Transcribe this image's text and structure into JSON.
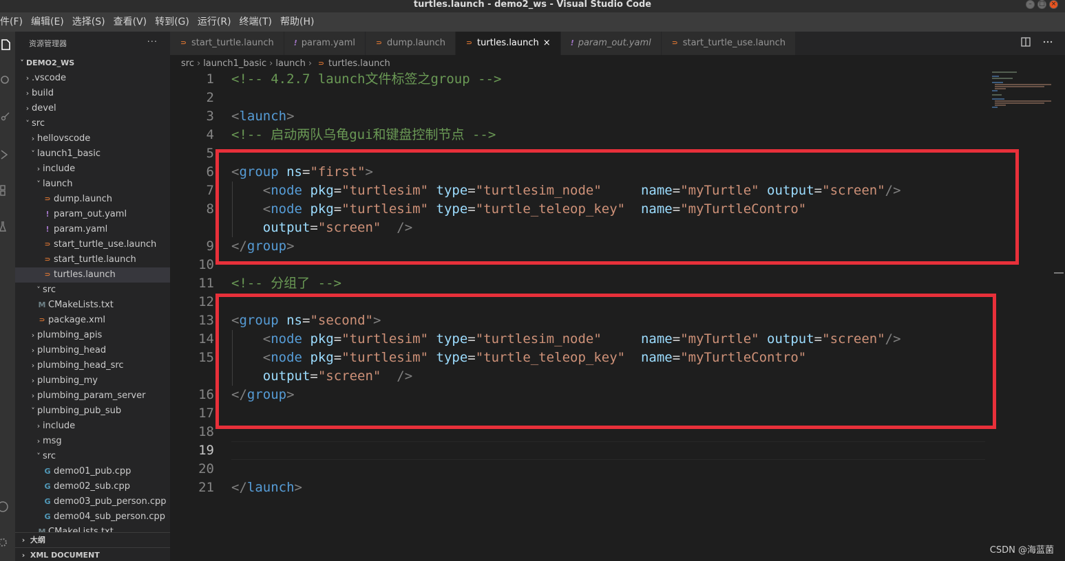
{
  "window": {
    "title": "turtles.launch - demo2_ws - Visual Studio Code",
    "buttons": [
      "–",
      "□",
      "×"
    ]
  },
  "menu": [
    "件(F)",
    "编辑(E)",
    "选择(S)",
    "查看(V)",
    "转到(G)",
    "运行(R)",
    "终端(T)",
    "帮助(H)"
  ],
  "activity_icons": [
    "files-icon",
    "search-icon",
    "source-control-icon",
    "run-debug-icon",
    "extensions-icon",
    "test-icon",
    "account-icon",
    "settings-gear-icon"
  ],
  "sidebar": {
    "header": "资源管理器",
    "more": "···",
    "tree": [
      {
        "label": "DEMO2_WS",
        "depth": 0,
        "chevron": "down",
        "icon": "",
        "root": true
      },
      {
        "label": ".vscode",
        "depth": 1,
        "chevron": "right",
        "icon": ""
      },
      {
        "label": "build",
        "depth": 1,
        "chevron": "right",
        "icon": ""
      },
      {
        "label": "devel",
        "depth": 1,
        "chevron": "right",
        "icon": ""
      },
      {
        "label": "src",
        "depth": 1,
        "chevron": "down",
        "icon": ""
      },
      {
        "label": "hellovscode",
        "depth": 2,
        "chevron": "right",
        "icon": ""
      },
      {
        "label": "launch1_basic",
        "depth": 2,
        "chevron": "down",
        "icon": ""
      },
      {
        "label": "include",
        "depth": 3,
        "chevron": "right",
        "icon": ""
      },
      {
        "label": "launch",
        "depth": 3,
        "chevron": "down",
        "icon": ""
      },
      {
        "label": "dump.launch",
        "depth": 4,
        "chevron": "",
        "icon": "rss"
      },
      {
        "label": "param_out.yaml",
        "depth": 4,
        "chevron": "",
        "icon": "yaml"
      },
      {
        "label": "param.yaml",
        "depth": 4,
        "chevron": "",
        "icon": "yaml"
      },
      {
        "label": "start_turtle_use.launch",
        "depth": 4,
        "chevron": "",
        "icon": "rss"
      },
      {
        "label": "start_turtle.launch",
        "depth": 4,
        "chevron": "",
        "icon": "rss"
      },
      {
        "label": "turtles.launch",
        "depth": 4,
        "chevron": "",
        "icon": "rss",
        "selected": true
      },
      {
        "label": "src",
        "depth": 3,
        "chevron": "down",
        "icon": ""
      },
      {
        "label": "CMakeLists.txt",
        "depth": 3,
        "chevron": "",
        "icon": "cmake"
      },
      {
        "label": "package.xml",
        "depth": 3,
        "chevron": "",
        "icon": "rss"
      },
      {
        "label": "plumbing_apis",
        "depth": 2,
        "chevron": "right",
        "icon": ""
      },
      {
        "label": "plumbing_head",
        "depth": 2,
        "chevron": "right",
        "icon": ""
      },
      {
        "label": "plumbing_head_src",
        "depth": 2,
        "chevron": "right",
        "icon": ""
      },
      {
        "label": "plumbing_my",
        "depth": 2,
        "chevron": "right",
        "icon": ""
      },
      {
        "label": "plumbing_param_server",
        "depth": 2,
        "chevron": "right",
        "icon": ""
      },
      {
        "label": "plumbing_pub_sub",
        "depth": 2,
        "chevron": "down",
        "icon": ""
      },
      {
        "label": "include",
        "depth": 3,
        "chevron": "right",
        "icon": ""
      },
      {
        "label": "msg",
        "depth": 3,
        "chevron": "right",
        "icon": ""
      },
      {
        "label": "src",
        "depth": 3,
        "chevron": "down",
        "icon": ""
      },
      {
        "label": "demo01_pub.cpp",
        "depth": 4,
        "chevron": "",
        "icon": "cpp"
      },
      {
        "label": "demo02_sub.cpp",
        "depth": 4,
        "chevron": "",
        "icon": "cpp"
      },
      {
        "label": "demo03_pub_person.cpp",
        "depth": 4,
        "chevron": "",
        "icon": "cpp"
      },
      {
        "label": "demo04_sub_person.cpp",
        "depth": 4,
        "chevron": "",
        "icon": "cpp"
      },
      {
        "label": "CMakeLists.txt",
        "depth": 3,
        "chevron": "",
        "icon": "cmake"
      }
    ],
    "outline_label": "大纲",
    "xml_document_label": "XML DOCUMENT"
  },
  "tabs": [
    {
      "label": "start_turtle.launch",
      "icon": "rss"
    },
    {
      "label": "param.yaml",
      "icon": "yaml"
    },
    {
      "label": "dump.launch",
      "icon": "rss"
    },
    {
      "label": "turtles.launch",
      "icon": "rss",
      "active": true,
      "close": "×"
    },
    {
      "label": "param_out.yaml",
      "icon": "yaml",
      "italic": true
    },
    {
      "label": "start_turtle_use.launch",
      "icon": "rss"
    }
  ],
  "tab_actions": [
    "split-editor-icon",
    "more-actions-icon"
  ],
  "breadcrumb": [
    "src",
    "launch1_basic",
    "launch",
    "turtles.launch"
  ],
  "code": [
    {
      "n": "1",
      "parts": [
        [
          "cmt",
          "<!-- 4.2.7 launch文件标签之group -->"
        ]
      ]
    },
    {
      "n": "2",
      "parts": []
    },
    {
      "n": "3",
      "parts": [
        [
          "punct",
          "<"
        ],
        [
          "tag",
          "launch"
        ],
        [
          "punct",
          ">"
        ]
      ]
    },
    {
      "n": "4",
      "parts": [
        [
          "cmt",
          "<!-- 启动两队乌龟gui和键盘控制节点 -->"
        ]
      ]
    },
    {
      "n": "5",
      "parts": []
    },
    {
      "n": "6",
      "parts": [
        [
          "punct",
          "<"
        ],
        [
          "tag",
          "group"
        ],
        [
          "plain",
          " "
        ],
        [
          "attr",
          "ns"
        ],
        [
          "plain",
          "="
        ],
        [
          "str",
          "\"first\""
        ],
        [
          "punct",
          ">"
        ]
      ]
    },
    {
      "n": "7",
      "parts": [
        [
          "plain",
          "    "
        ],
        [
          "punct",
          "<"
        ],
        [
          "tag",
          "node"
        ],
        [
          "plain",
          " "
        ],
        [
          "attr",
          "pkg"
        ],
        [
          "plain",
          "="
        ],
        [
          "str",
          "\"turtlesim\""
        ],
        [
          "plain",
          " "
        ],
        [
          "attr",
          "type"
        ],
        [
          "plain",
          "="
        ],
        [
          "str",
          "\"turtlesim_node\""
        ],
        [
          "plain",
          "     "
        ],
        [
          "attr",
          "name"
        ],
        [
          "plain",
          "="
        ],
        [
          "str",
          "\"myTurtle\""
        ],
        [
          "plain",
          " "
        ],
        [
          "attr",
          "output"
        ],
        [
          "plain",
          "="
        ],
        [
          "str",
          "\"screen\""
        ],
        [
          "punct",
          "/>"
        ]
      ]
    },
    {
      "n": "8",
      "parts": [
        [
          "plain",
          "    "
        ],
        [
          "punct",
          "<"
        ],
        [
          "tag",
          "node"
        ],
        [
          "plain",
          " "
        ],
        [
          "attr",
          "pkg"
        ],
        [
          "plain",
          "="
        ],
        [
          "str",
          "\"turtlesim\""
        ],
        [
          "plain",
          " "
        ],
        [
          "attr",
          "type"
        ],
        [
          "plain",
          "="
        ],
        [
          "str",
          "\"turtle_teleop_key\""
        ],
        [
          "plain",
          "  "
        ],
        [
          "attr",
          "name"
        ],
        [
          "plain",
          "="
        ],
        [
          "str",
          "\"myTurtleContro\""
        ]
      ]
    },
    {
      "n": "",
      "parts": [
        [
          "plain",
          "    "
        ],
        [
          "attr",
          "output"
        ],
        [
          "plain",
          "="
        ],
        [
          "str",
          "\"screen\""
        ],
        [
          "plain",
          "  "
        ],
        [
          "punct",
          "/>"
        ]
      ]
    },
    {
      "n": "9",
      "parts": [
        [
          "punct",
          "</"
        ],
        [
          "tag",
          "group"
        ],
        [
          "punct",
          ">"
        ]
      ]
    },
    {
      "n": "10",
      "parts": []
    },
    {
      "n": "11",
      "parts": [
        [
          "cmt",
          "<!-- 分组了 -->"
        ]
      ]
    },
    {
      "n": "12",
      "parts": []
    },
    {
      "n": "13",
      "parts": [
        [
          "punct",
          "<"
        ],
        [
          "tag",
          "group"
        ],
        [
          "plain",
          " "
        ],
        [
          "attr",
          "ns"
        ],
        [
          "plain",
          "="
        ],
        [
          "str",
          "\"second\""
        ],
        [
          "punct",
          ">"
        ]
      ]
    },
    {
      "n": "14",
      "parts": [
        [
          "plain",
          "    "
        ],
        [
          "punct",
          "<"
        ],
        [
          "tag",
          "node"
        ],
        [
          "plain",
          " "
        ],
        [
          "attr",
          "pkg"
        ],
        [
          "plain",
          "="
        ],
        [
          "str",
          "\"turtlesim\""
        ],
        [
          "plain",
          " "
        ],
        [
          "attr",
          "type"
        ],
        [
          "plain",
          "="
        ],
        [
          "str",
          "\"turtlesim_node\""
        ],
        [
          "plain",
          "     "
        ],
        [
          "attr",
          "name"
        ],
        [
          "plain",
          "="
        ],
        [
          "str",
          "\"myTurtle\""
        ],
        [
          "plain",
          " "
        ],
        [
          "attr",
          "output"
        ],
        [
          "plain",
          "="
        ],
        [
          "str",
          "\"screen\""
        ],
        [
          "punct",
          "/>"
        ]
      ]
    },
    {
      "n": "15",
      "parts": [
        [
          "plain",
          "    "
        ],
        [
          "punct",
          "<"
        ],
        [
          "tag",
          "node"
        ],
        [
          "plain",
          " "
        ],
        [
          "attr",
          "pkg"
        ],
        [
          "plain",
          "="
        ],
        [
          "str",
          "\"turtlesim\""
        ],
        [
          "plain",
          " "
        ],
        [
          "attr",
          "type"
        ],
        [
          "plain",
          "="
        ],
        [
          "str",
          "\"turtle_teleop_key\""
        ],
        [
          "plain",
          "  "
        ],
        [
          "attr",
          "name"
        ],
        [
          "plain",
          "="
        ],
        [
          "str",
          "\"myTurtleContro\""
        ]
      ]
    },
    {
      "n": "",
      "parts": [
        [
          "plain",
          "    "
        ],
        [
          "attr",
          "output"
        ],
        [
          "plain",
          "="
        ],
        [
          "str",
          "\"screen\""
        ],
        [
          "plain",
          "  "
        ],
        [
          "punct",
          "/>"
        ]
      ]
    },
    {
      "n": "16",
      "parts": [
        [
          "punct",
          "</"
        ],
        [
          "tag",
          "group"
        ],
        [
          "punct",
          ">"
        ]
      ]
    },
    {
      "n": "17",
      "parts": []
    },
    {
      "n": "18",
      "parts": []
    },
    {
      "n": "19",
      "parts": [],
      "current": true
    },
    {
      "n": "20",
      "parts": []
    },
    {
      "n": "21",
      "parts": [
        [
          "punct",
          "</"
        ],
        [
          "tag",
          "launch"
        ],
        [
          "punct",
          ">"
        ]
      ]
    }
  ],
  "watermark": "CSDN @海蓝菌"
}
